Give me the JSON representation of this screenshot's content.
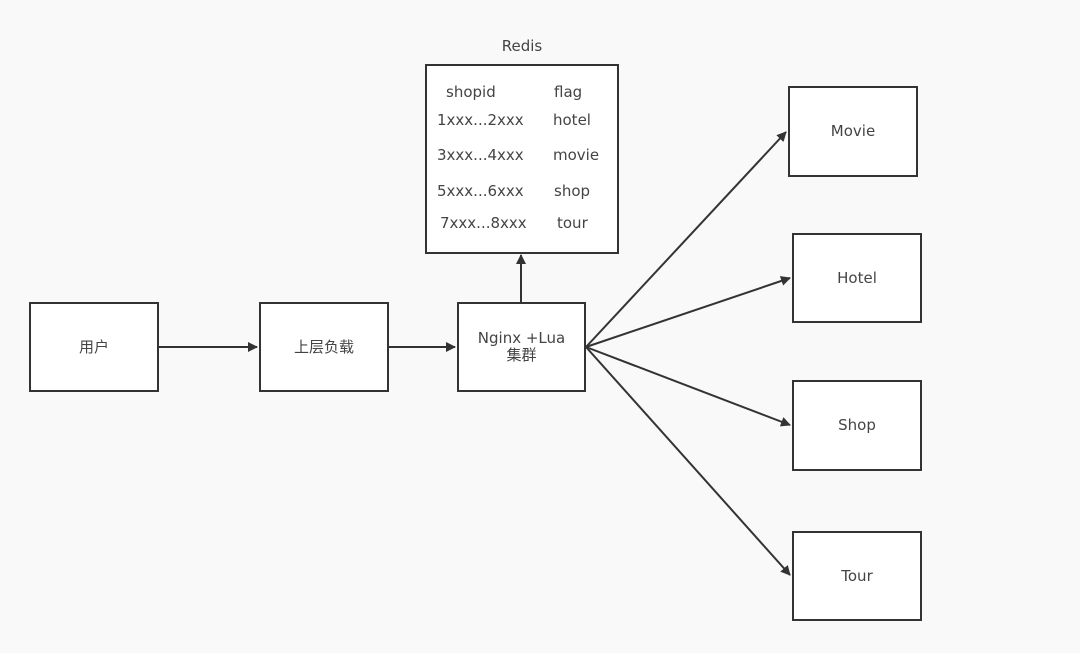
{
  "nodes": {
    "user": "用户",
    "load_balancer": "上层负载",
    "nginx": [
      "Nginx +Lua",
      "集群"
    ],
    "movie": "Movie",
    "hotel": "Hotel",
    "shop": "Shop",
    "tour": "Tour"
  },
  "redis": {
    "title": "Redis",
    "headers": [
      "shopid",
      "flag"
    ],
    "rows": [
      [
        "1xxx...2xxx",
        "hotel"
      ],
      [
        "3xxx...4xxx",
        "movie"
      ],
      [
        "5xxx...6xxx",
        "shop"
      ],
      [
        "7xxx...8xxx",
        "tour"
      ]
    ]
  },
  "edges": [
    {
      "from": "user",
      "to": "load_balancer"
    },
    {
      "from": "load_balancer",
      "to": "nginx"
    },
    {
      "from": "nginx",
      "to": "redis"
    },
    {
      "from": "nginx",
      "to": "movie"
    },
    {
      "from": "nginx",
      "to": "hotel"
    },
    {
      "from": "nginx",
      "to": "shop"
    },
    {
      "from": "nginx",
      "to": "tour"
    }
  ]
}
